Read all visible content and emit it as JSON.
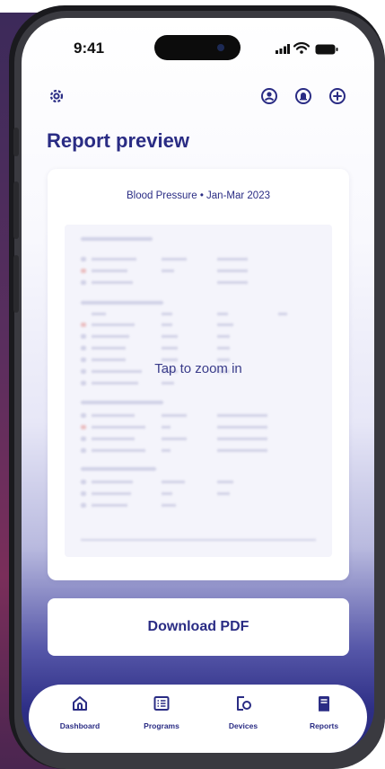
{
  "status_bar": {
    "time": "9:41"
  },
  "header": {
    "title": "Report preview"
  },
  "report": {
    "title": "Blood Pressure • Jan-Mar 2023",
    "zoom_hint": "Tap to zoom in"
  },
  "actions": {
    "download_label": "Download PDF"
  },
  "nav": {
    "items": [
      {
        "label": "Dashboard",
        "icon": "home-icon"
      },
      {
        "label": "Programs",
        "icon": "list-icon"
      },
      {
        "label": "Devices",
        "icon": "devices-icon"
      },
      {
        "label": "Reports",
        "icon": "report-icon"
      }
    ]
  },
  "colors": {
    "accent": "#2a2c84",
    "alert_dot": "#e05a5a",
    "screen_bottom": "#272a7e"
  }
}
